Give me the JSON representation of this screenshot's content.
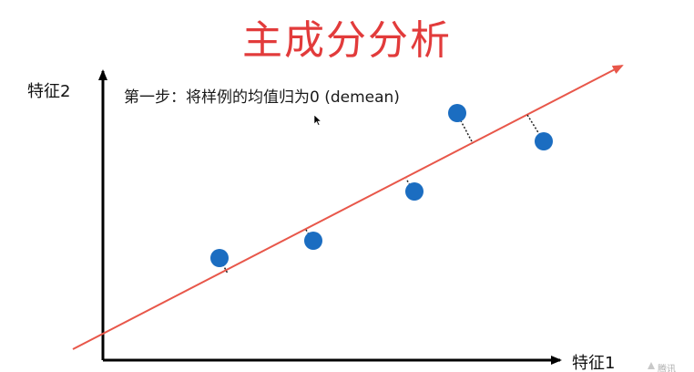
{
  "title": "主成分分析",
  "step_text": "第一步：将样例的均值归为0 (demean)",
  "axes": {
    "x_label": "特征1",
    "y_label": "特征2"
  },
  "watermark": "腾讯",
  "colors": {
    "title": "#e23b3b",
    "fit_line": "#e8574a",
    "point": "#1b6dc1",
    "axis": "#000000",
    "projection": "#222222"
  },
  "icons": {
    "cursor": "arrow-cursor-icon"
  }
}
